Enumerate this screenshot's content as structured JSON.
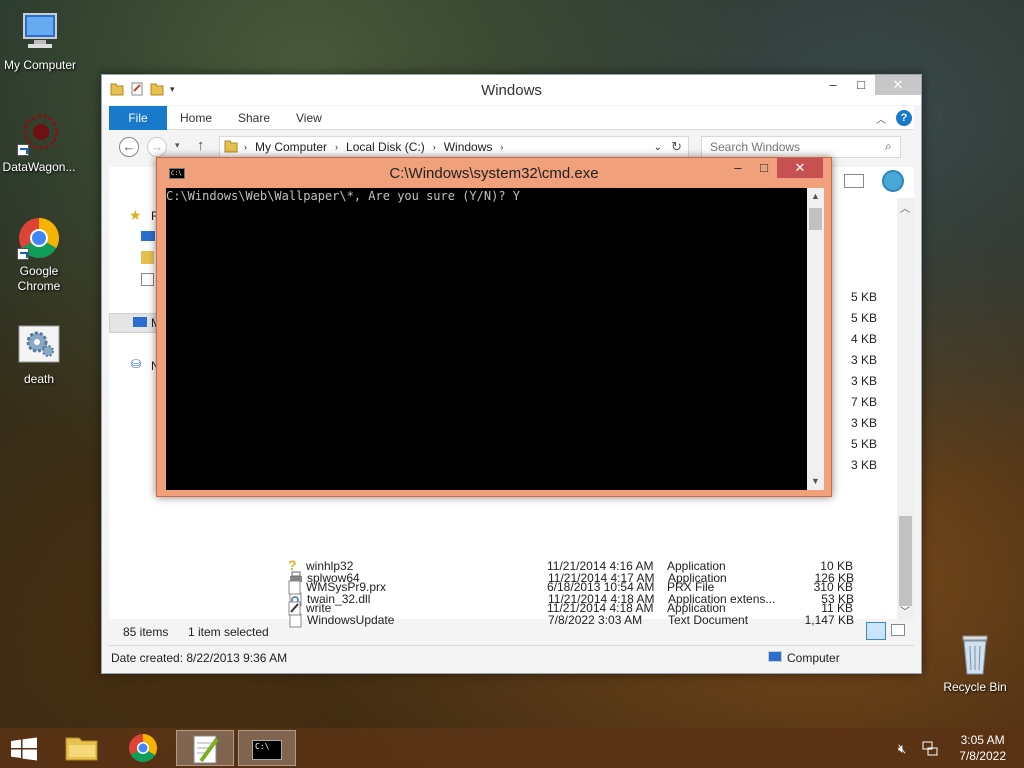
{
  "desktop": {
    "icons": [
      {
        "label": "My Computer"
      },
      {
        "label": "DataWagon..."
      },
      {
        "label": "Google Chrome"
      },
      {
        "label": "death"
      },
      {
        "label": "Recycle Bin"
      }
    ]
  },
  "explorer": {
    "title": "Windows",
    "tabs": [
      "File",
      "Home",
      "Share",
      "View"
    ],
    "breadcrumb": [
      "My Computer",
      "Local Disk (C:)",
      "Windows"
    ],
    "search_placeholder": "Search Windows",
    "nav_letters": [
      "F",
      "M",
      "N"
    ],
    "partial_sizes": [
      "5 KB",
      "5 KB",
      "4 KB",
      "3 KB",
      "3 KB",
      "7 KB",
      "3 KB",
      "5 KB",
      "3 KB"
    ],
    "files": [
      {
        "name": "splwow64",
        "date": "11/21/2014 4:17 AM",
        "type": "Application",
        "size": "126 KB"
      },
      {
        "name": "twain_32.dll",
        "date": "11/21/2014 4:18 AM",
        "type": "Application extens...",
        "size": "53 KB"
      },
      {
        "name": "WindowsUpdate",
        "date": "7/8/2022 3:03 AM",
        "type": "Text Document",
        "size": "1,147 KB"
      },
      {
        "name": "winhlp32",
        "date": "11/21/2014 4:16 AM",
        "type": "Application",
        "size": "10 KB"
      },
      {
        "name": "WMSysPr9.prx",
        "date": "6/18/2013 10:54 AM",
        "type": "PRX File",
        "size": "310 KB"
      },
      {
        "name": "write",
        "date": "11/21/2014 4:18 AM",
        "type": "Application",
        "size": "11 KB"
      }
    ],
    "status": {
      "items": "85 items",
      "selected": "1 item selected"
    },
    "details": {
      "created": "Date created: 8/22/2013 9:36 AM",
      "location": "Computer"
    }
  },
  "cmd": {
    "title": "C:\\Windows\\system32\\cmd.exe",
    "icon_text": "C:\\",
    "output": "C:\\Windows\\Web\\Wallpaper\\*, Are you sure (Y/N)? Y"
  },
  "taskbar": {
    "time": "3:05 AM",
    "date": "7/8/2022",
    "cmd_label": "C:\\"
  }
}
